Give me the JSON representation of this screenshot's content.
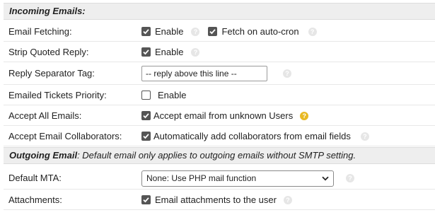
{
  "incoming": {
    "header": "Incoming Emails:",
    "rows": [
      {
        "label": "Email Fetching:",
        "option1": "Enable",
        "option2": "Fetch on auto-cron"
      },
      {
        "label": "Strip Quoted Reply:",
        "option1": "Enable"
      },
      {
        "label": "Reply Separator Tag:",
        "value": "-- reply above this line --"
      },
      {
        "label": "Emailed Tickets Priority:",
        "option1": "Enable"
      },
      {
        "label": "Accept All Emails:",
        "option1": "Accept email from unknown Users"
      },
      {
        "label": "Accept Email Collaborators:",
        "option1": "Automatically add collaborators from email fields"
      }
    ]
  },
  "outgoing": {
    "header_bold": "Outgoing Email",
    "header_rest": ": Default email only applies to outgoing emails without SMTP setting.",
    "rows": [
      {
        "label": "Default MTA:",
        "selected": "None: Use PHP mail function"
      },
      {
        "label": "Attachments:",
        "option1": "Email attachments to the user"
      }
    ]
  },
  "checkbox_states": {
    "email_fetching_enable": true,
    "fetch_on_autocron": true,
    "strip_quoted_reply": true,
    "emailed_tickets_priority": false,
    "accept_all_emails": true,
    "accept_collaborators": true,
    "attachments": true
  },
  "icons": {
    "help": "help-circle-icon",
    "warning_help": "warning-help-icon",
    "check": "checkmark-icon",
    "dropdown": "chevron-down-icon"
  },
  "colors": {
    "header_bg": "#eeeeee",
    "checkbox_checked": "#555555",
    "warning_icon": "#e8b923",
    "help_icon": "#e6e6e6"
  }
}
